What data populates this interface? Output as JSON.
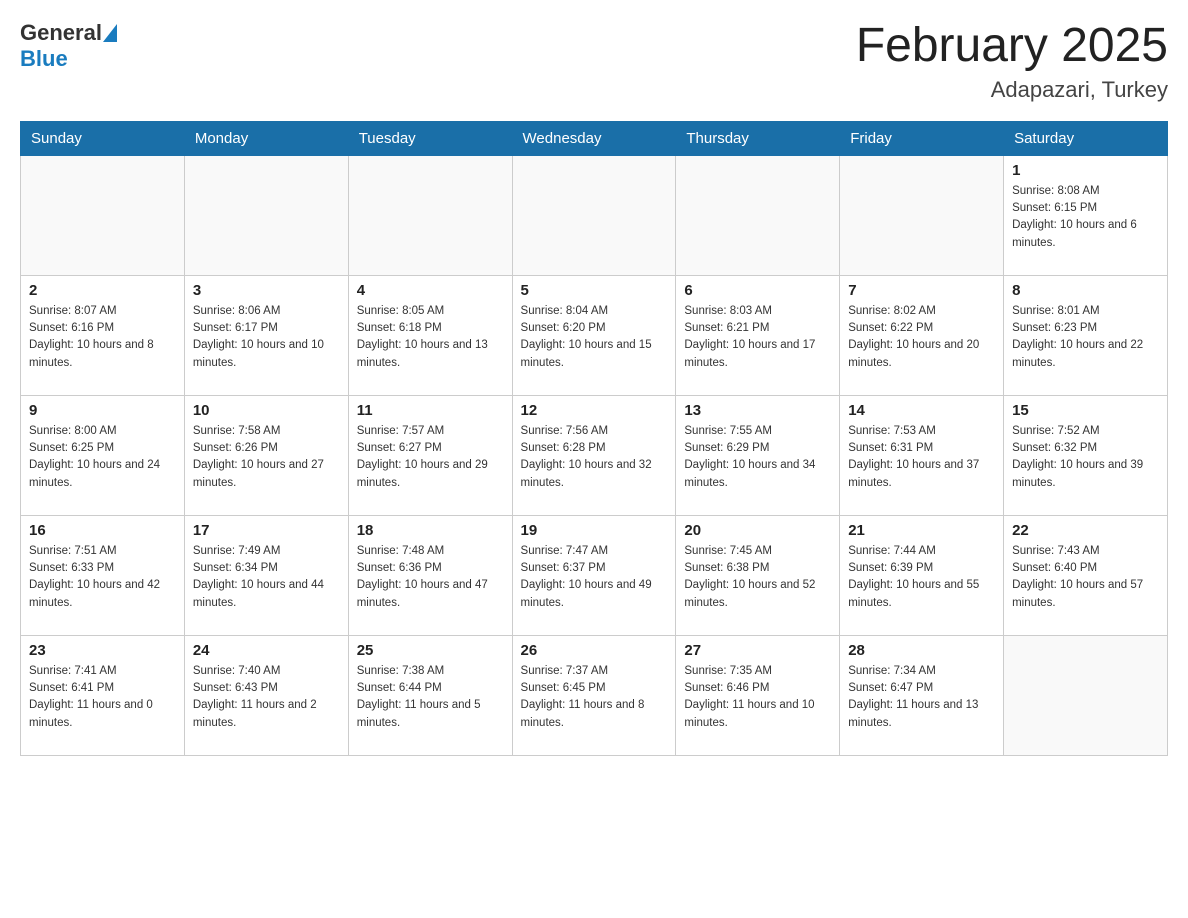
{
  "header": {
    "logo_general": "General",
    "logo_blue": "Blue",
    "title": "February 2025",
    "subtitle": "Adapazari, Turkey"
  },
  "calendar": {
    "days_of_week": [
      "Sunday",
      "Monday",
      "Tuesday",
      "Wednesday",
      "Thursday",
      "Friday",
      "Saturday"
    ],
    "weeks": [
      [
        {
          "day": "",
          "info": ""
        },
        {
          "day": "",
          "info": ""
        },
        {
          "day": "",
          "info": ""
        },
        {
          "day": "",
          "info": ""
        },
        {
          "day": "",
          "info": ""
        },
        {
          "day": "",
          "info": ""
        },
        {
          "day": "1",
          "info": "Sunrise: 8:08 AM\nSunset: 6:15 PM\nDaylight: 10 hours and 6 minutes."
        }
      ],
      [
        {
          "day": "2",
          "info": "Sunrise: 8:07 AM\nSunset: 6:16 PM\nDaylight: 10 hours and 8 minutes."
        },
        {
          "day": "3",
          "info": "Sunrise: 8:06 AM\nSunset: 6:17 PM\nDaylight: 10 hours and 10 minutes."
        },
        {
          "day": "4",
          "info": "Sunrise: 8:05 AM\nSunset: 6:18 PM\nDaylight: 10 hours and 13 minutes."
        },
        {
          "day": "5",
          "info": "Sunrise: 8:04 AM\nSunset: 6:20 PM\nDaylight: 10 hours and 15 minutes."
        },
        {
          "day": "6",
          "info": "Sunrise: 8:03 AM\nSunset: 6:21 PM\nDaylight: 10 hours and 17 minutes."
        },
        {
          "day": "7",
          "info": "Sunrise: 8:02 AM\nSunset: 6:22 PM\nDaylight: 10 hours and 20 minutes."
        },
        {
          "day": "8",
          "info": "Sunrise: 8:01 AM\nSunset: 6:23 PM\nDaylight: 10 hours and 22 minutes."
        }
      ],
      [
        {
          "day": "9",
          "info": "Sunrise: 8:00 AM\nSunset: 6:25 PM\nDaylight: 10 hours and 24 minutes."
        },
        {
          "day": "10",
          "info": "Sunrise: 7:58 AM\nSunset: 6:26 PM\nDaylight: 10 hours and 27 minutes."
        },
        {
          "day": "11",
          "info": "Sunrise: 7:57 AM\nSunset: 6:27 PM\nDaylight: 10 hours and 29 minutes."
        },
        {
          "day": "12",
          "info": "Sunrise: 7:56 AM\nSunset: 6:28 PM\nDaylight: 10 hours and 32 minutes."
        },
        {
          "day": "13",
          "info": "Sunrise: 7:55 AM\nSunset: 6:29 PM\nDaylight: 10 hours and 34 minutes."
        },
        {
          "day": "14",
          "info": "Sunrise: 7:53 AM\nSunset: 6:31 PM\nDaylight: 10 hours and 37 minutes."
        },
        {
          "day": "15",
          "info": "Sunrise: 7:52 AM\nSunset: 6:32 PM\nDaylight: 10 hours and 39 minutes."
        }
      ],
      [
        {
          "day": "16",
          "info": "Sunrise: 7:51 AM\nSunset: 6:33 PM\nDaylight: 10 hours and 42 minutes."
        },
        {
          "day": "17",
          "info": "Sunrise: 7:49 AM\nSunset: 6:34 PM\nDaylight: 10 hours and 44 minutes."
        },
        {
          "day": "18",
          "info": "Sunrise: 7:48 AM\nSunset: 6:36 PM\nDaylight: 10 hours and 47 minutes."
        },
        {
          "day": "19",
          "info": "Sunrise: 7:47 AM\nSunset: 6:37 PM\nDaylight: 10 hours and 49 minutes."
        },
        {
          "day": "20",
          "info": "Sunrise: 7:45 AM\nSunset: 6:38 PM\nDaylight: 10 hours and 52 minutes."
        },
        {
          "day": "21",
          "info": "Sunrise: 7:44 AM\nSunset: 6:39 PM\nDaylight: 10 hours and 55 minutes."
        },
        {
          "day": "22",
          "info": "Sunrise: 7:43 AM\nSunset: 6:40 PM\nDaylight: 10 hours and 57 minutes."
        }
      ],
      [
        {
          "day": "23",
          "info": "Sunrise: 7:41 AM\nSunset: 6:41 PM\nDaylight: 11 hours and 0 minutes."
        },
        {
          "day": "24",
          "info": "Sunrise: 7:40 AM\nSunset: 6:43 PM\nDaylight: 11 hours and 2 minutes."
        },
        {
          "day": "25",
          "info": "Sunrise: 7:38 AM\nSunset: 6:44 PM\nDaylight: 11 hours and 5 minutes."
        },
        {
          "day": "26",
          "info": "Sunrise: 7:37 AM\nSunset: 6:45 PM\nDaylight: 11 hours and 8 minutes."
        },
        {
          "day": "27",
          "info": "Sunrise: 7:35 AM\nSunset: 6:46 PM\nDaylight: 11 hours and 10 minutes."
        },
        {
          "day": "28",
          "info": "Sunrise: 7:34 AM\nSunset: 6:47 PM\nDaylight: 11 hours and 13 minutes."
        },
        {
          "day": "",
          "info": ""
        }
      ]
    ]
  }
}
